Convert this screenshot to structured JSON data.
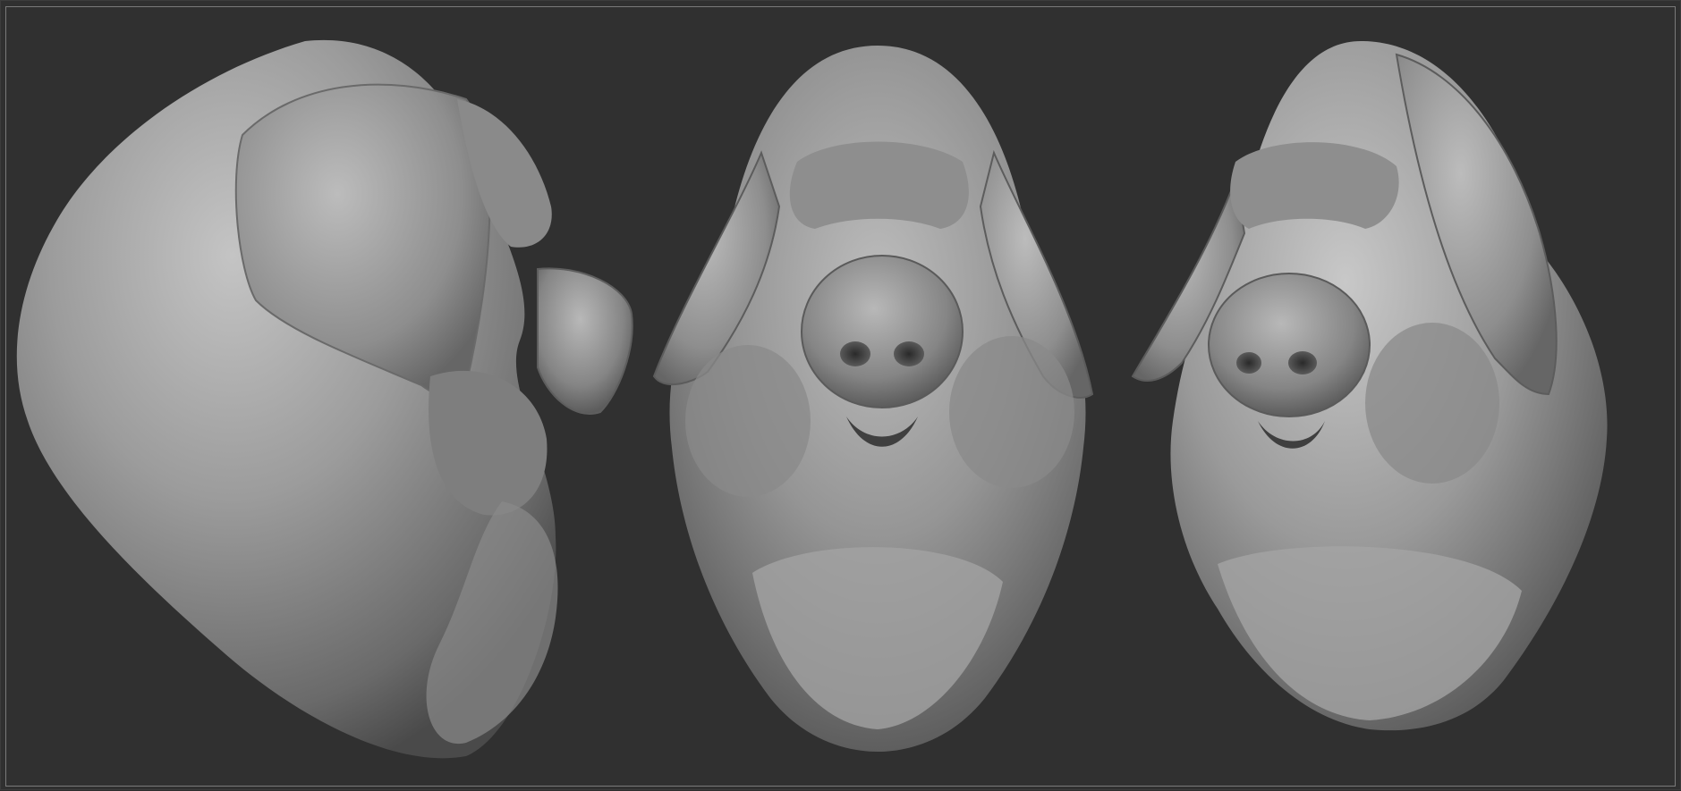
{
  "scene": {
    "background_color": "#303030",
    "frame_color": "#7a7a7a",
    "clay_color": "#9a9a9a",
    "subject": "pig-head-sculpt",
    "views": [
      {
        "view": "side"
      },
      {
        "view": "front"
      },
      {
        "view": "three-quarter"
      }
    ]
  }
}
